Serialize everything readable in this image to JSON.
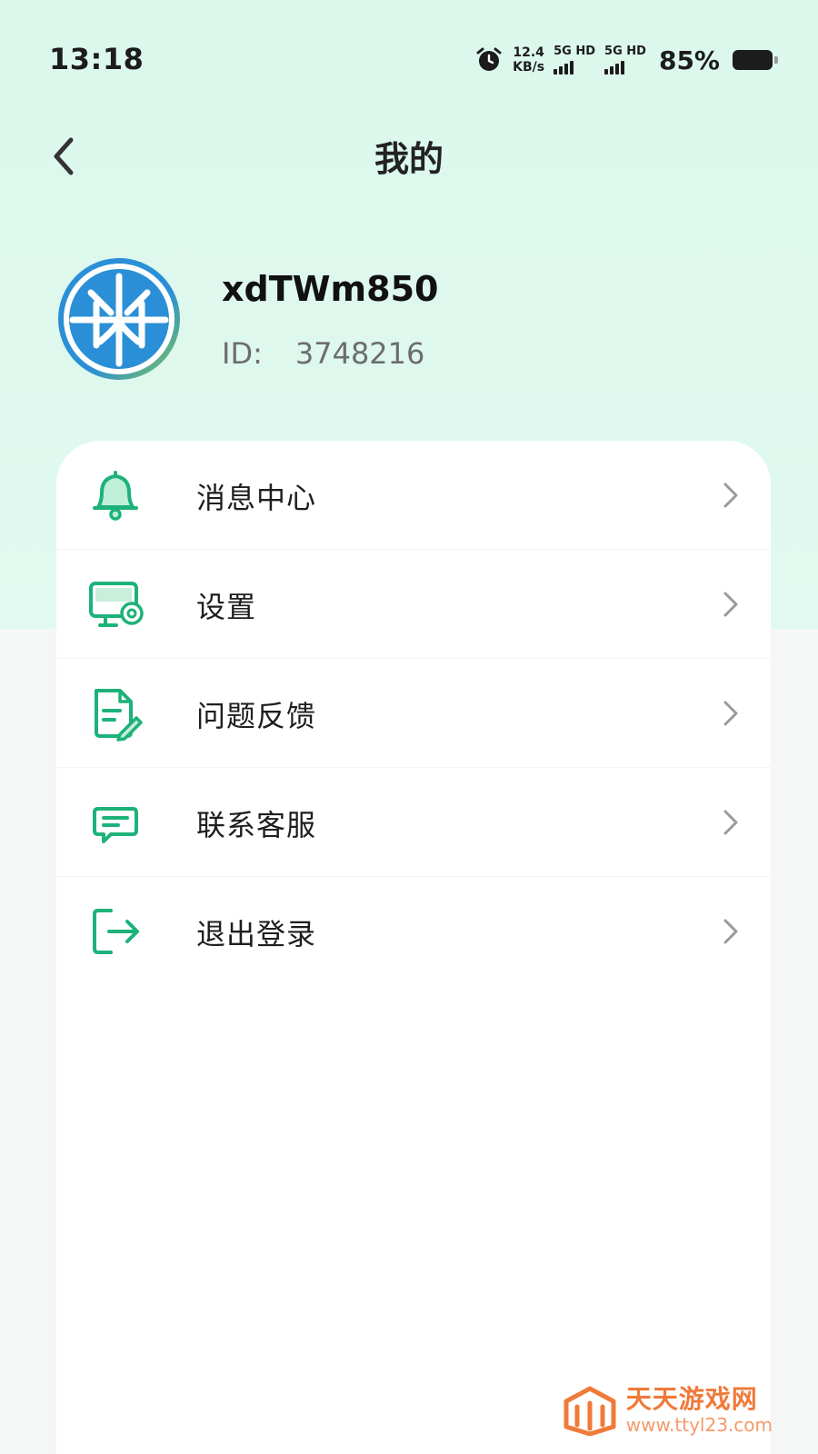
{
  "status_bar": {
    "time": "13:18",
    "net_speed_value": "12.4",
    "net_speed_unit": "KB/s",
    "sim1_label": "5G HD",
    "sim2_label": "5G HD",
    "battery_percent": "85%",
    "icons": [
      "alarm-icon",
      "signal-icon",
      "battery-icon"
    ]
  },
  "nav": {
    "title": "我的",
    "back_icon": "chevron-left-icon"
  },
  "profile": {
    "username": "xdTWm850",
    "id_label": "ID:",
    "id_value": "3748216"
  },
  "menu": {
    "items": [
      {
        "label": "消息中心",
        "icon": "bell-icon"
      },
      {
        "label": "设置",
        "icon": "monitor-settings-icon"
      },
      {
        "label": "问题反馈",
        "icon": "document-edit-icon"
      },
      {
        "label": "联系客服",
        "icon": "chat-bubble-icon"
      },
      {
        "label": "退出登录",
        "icon": "logout-icon"
      }
    ]
  },
  "watermark": {
    "title": "天天游戏网",
    "url": "www.ttyl23.com"
  },
  "colors": {
    "accent": "#1db27a",
    "header_bg": "#dcf7ec",
    "page_bg": "#f5f6f6",
    "card_bg": "#ffffff",
    "watermark": "#f07a3a"
  }
}
